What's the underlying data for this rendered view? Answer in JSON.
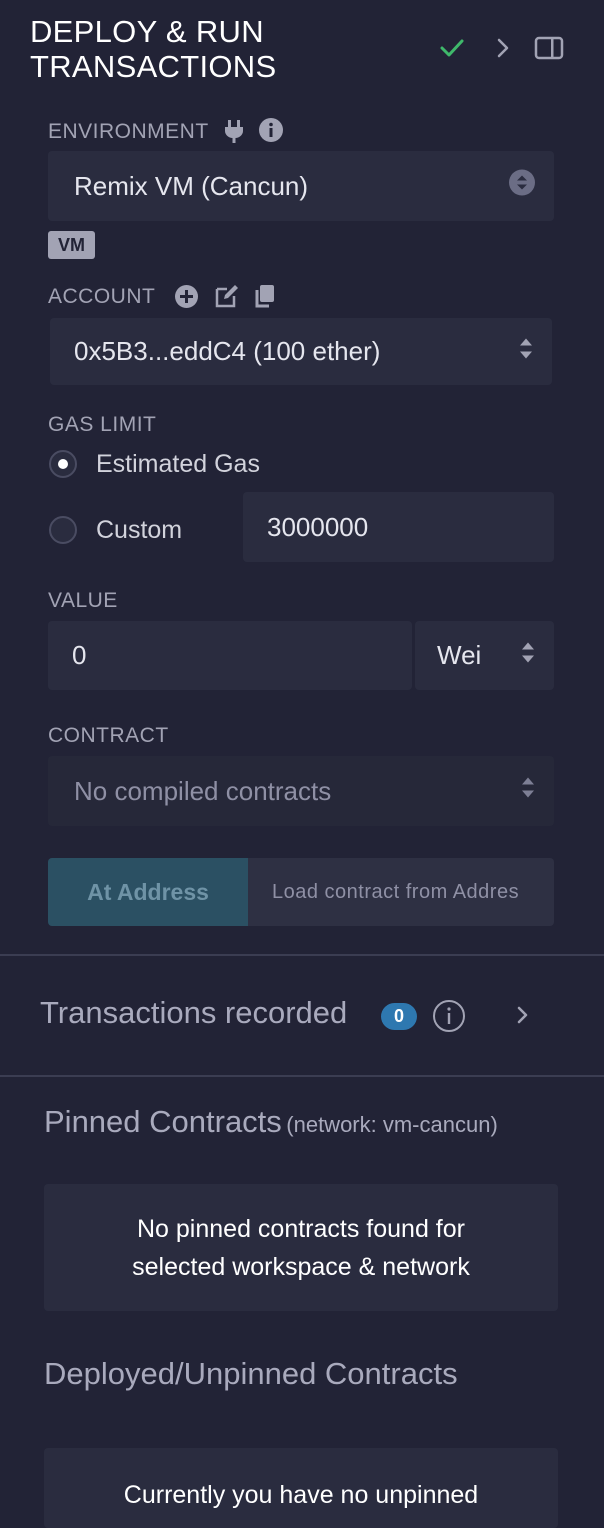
{
  "header": {
    "title": "DEPLOY & RUN TRANSACTIONS",
    "icons": [
      "check-icon",
      "chevron-right-icon",
      "panel-toggle-icon"
    ],
    "accent_color": "#3fb86b"
  },
  "environment": {
    "label": "ENVIRONMENT",
    "value": "Remix VM (Cancun)",
    "badge": "VM"
  },
  "account": {
    "label": "ACCOUNT",
    "value": "0x5B3...eddC4 (100 ether)"
  },
  "gas_limit": {
    "label": "GAS LIMIT",
    "options": [
      "Estimated Gas",
      "Custom"
    ],
    "selected": "Estimated Gas",
    "custom_value": "3000000"
  },
  "value": {
    "label": "VALUE",
    "amount": "0",
    "unit": "Wei"
  },
  "contract": {
    "label": "CONTRACT",
    "value": "No compiled contracts",
    "at_address_button": "At Address",
    "load_placeholder": "Load contract from Addres"
  },
  "transactions": {
    "label": "Transactions recorded",
    "count": "0"
  },
  "pinned": {
    "title": "Pinned Contracts",
    "network": "(network: vm-cancun)",
    "empty_line1": "No pinned contracts found for",
    "empty_line2": "selected workspace & network"
  },
  "deployed": {
    "title": "Deployed/Unpinned Contracts",
    "empty_text": "Currently you have no unpinned"
  }
}
